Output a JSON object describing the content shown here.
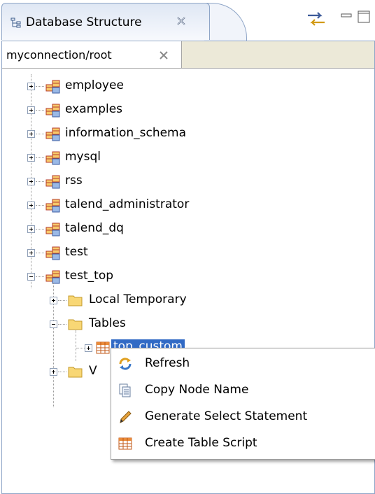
{
  "view": {
    "title": "Database Structure"
  },
  "editor": {
    "tab_label": "myconnection/root"
  },
  "tree": {
    "databases": [
      "employee",
      "examples",
      "information_schema",
      "mysql",
      "rss",
      "talend_administrator",
      "talend_dq",
      "test",
      "test_top"
    ],
    "test_top_children": [
      "Local Temporary",
      "Tables"
    ],
    "selected_table": "top_custom",
    "partial_folder": "V"
  },
  "context_menu": {
    "items": [
      {
        "label": "Refresh",
        "icon": "refresh-icon"
      },
      {
        "label": "Copy Node Name",
        "icon": "copy-icon"
      },
      {
        "label": "Generate Select Statement",
        "icon": "pencil-icon"
      },
      {
        "label": "Create Table Script",
        "icon": "table-icon"
      }
    ]
  }
}
